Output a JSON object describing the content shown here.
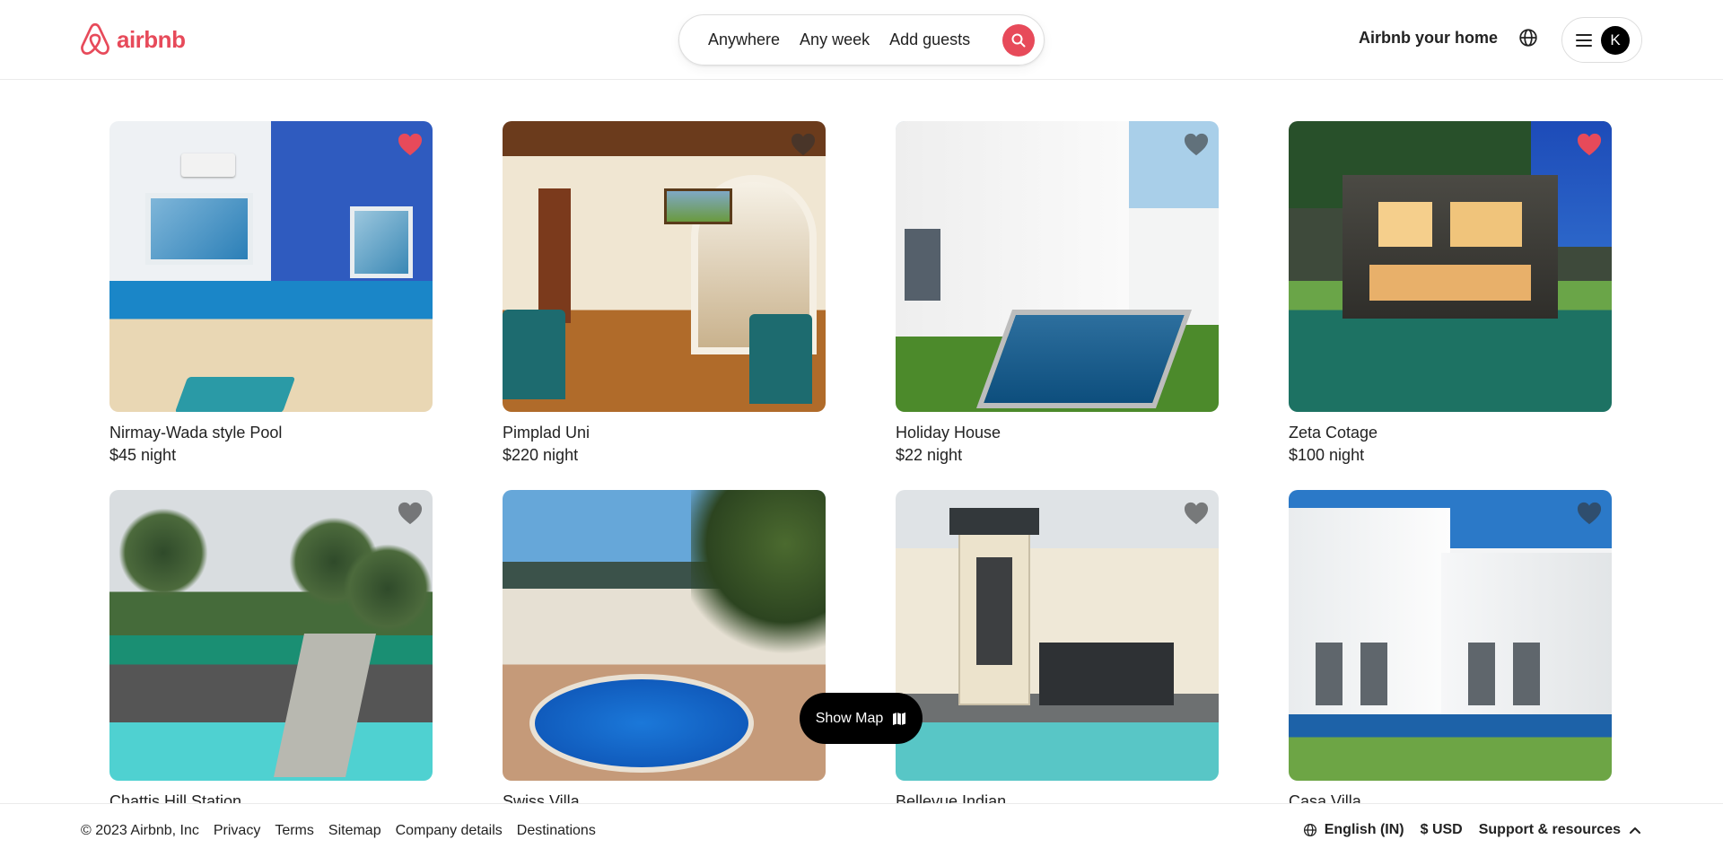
{
  "brand": {
    "name": "airbnb",
    "color": "#e74a5a"
  },
  "header": {
    "search": {
      "anywhere_label": "Anywhere",
      "week_label": "Any week",
      "guests_label": "Add guests",
      "search_icon": "search-icon"
    },
    "host_link": "Airbnb your home",
    "globe_icon": "globe-icon",
    "menu_icon": "hamburger-icon",
    "avatar_initial": "K"
  },
  "listings": [
    {
      "title": "Nirmay-Wada style Pool",
      "price": "$45 night",
      "favorited": true
    },
    {
      "title": "Pimplad Uni",
      "price": "$220 night",
      "favorited": false
    },
    {
      "title": "Holiday House",
      "price": "$22 night",
      "favorited": false
    },
    {
      "title": "Zeta Cotage",
      "price": "$100 night",
      "favorited": true
    },
    {
      "title": "Chattis Hill Station",
      "price": "",
      "favorited": false
    },
    {
      "title": "Swiss Villa",
      "price": "",
      "favorited": false
    },
    {
      "title": "Bellevue Indian",
      "price": "",
      "favorited": false
    },
    {
      "title": "Casa Villa",
      "price": "",
      "favorited": false
    }
  ],
  "colors": {
    "heart_active": "#e74a5a",
    "heart_inactive": "rgba(60,60,60,0.6)"
  },
  "show_map": {
    "label": "Show Map",
    "icon": "map-icon"
  },
  "footer": {
    "copyright": "© 2023 Airbnb, Inc",
    "links": [
      "Privacy",
      "Terms",
      "Sitemap",
      "Company details",
      "Destinations"
    ],
    "language": "English (IN)",
    "currency": "$ USD",
    "support": "Support & resources"
  }
}
